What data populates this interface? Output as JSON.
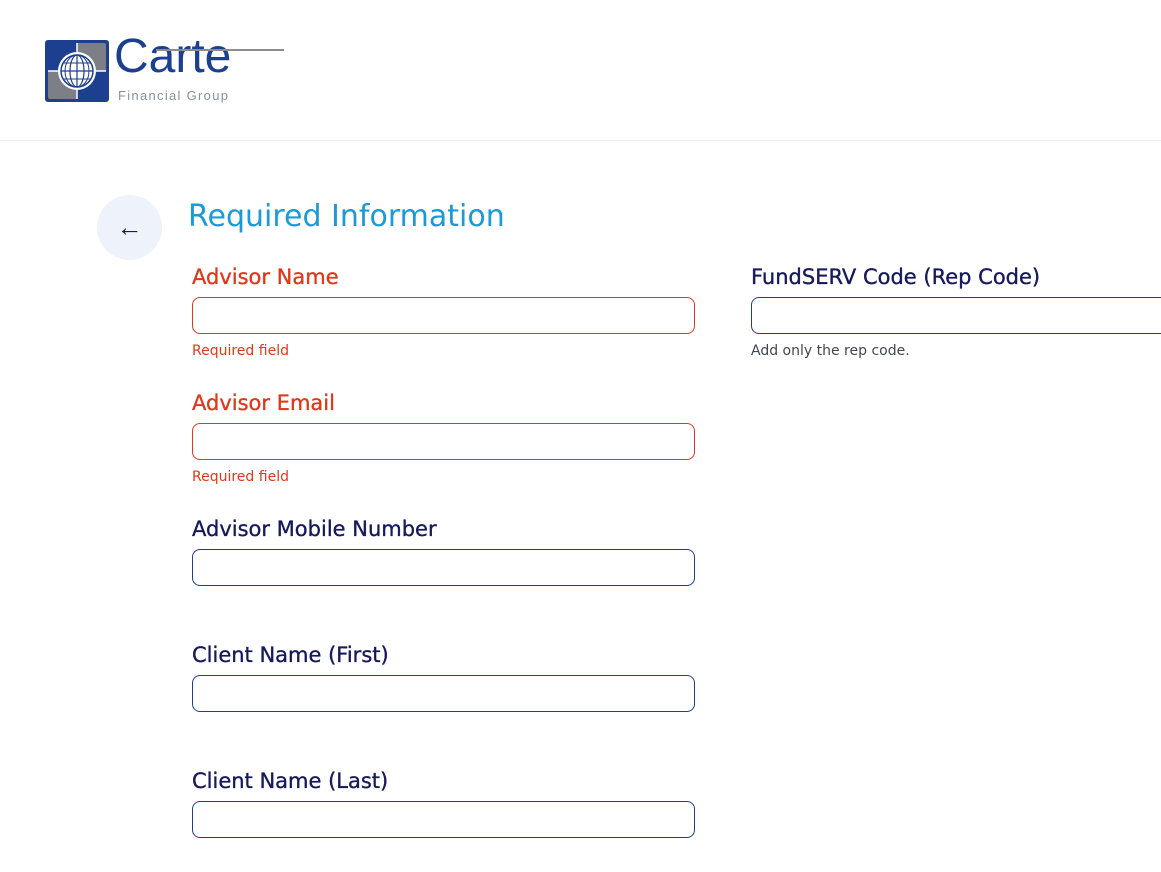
{
  "logo": {
    "wordmark": "Carte",
    "subtitle": "Financial Group"
  },
  "back": {
    "icon": "arrow-left-icon",
    "glyph": "←"
  },
  "page_title": "Required Information",
  "fields": {
    "advisor_name": {
      "label": "Advisor Name",
      "value": "",
      "help": "Required field"
    },
    "advisor_email": {
      "label": "Advisor Email",
      "value": "",
      "help": "Required field"
    },
    "advisor_mobile": {
      "label": "Advisor Mobile Number",
      "value": ""
    },
    "client_first": {
      "label": "Client Name (First)",
      "value": ""
    },
    "client_last": {
      "label": "Client Name (Last)",
      "value": ""
    },
    "fundserv_code": {
      "label": "FundSERV Code (Rep Code)",
      "value": "",
      "help": "Add only the rep code."
    }
  },
  "colors": {
    "brand_navy": "#1d3f8f",
    "title_blue": "#1b9ad6",
    "error_red": "#e0381b",
    "label_navy": "#16195a"
  }
}
